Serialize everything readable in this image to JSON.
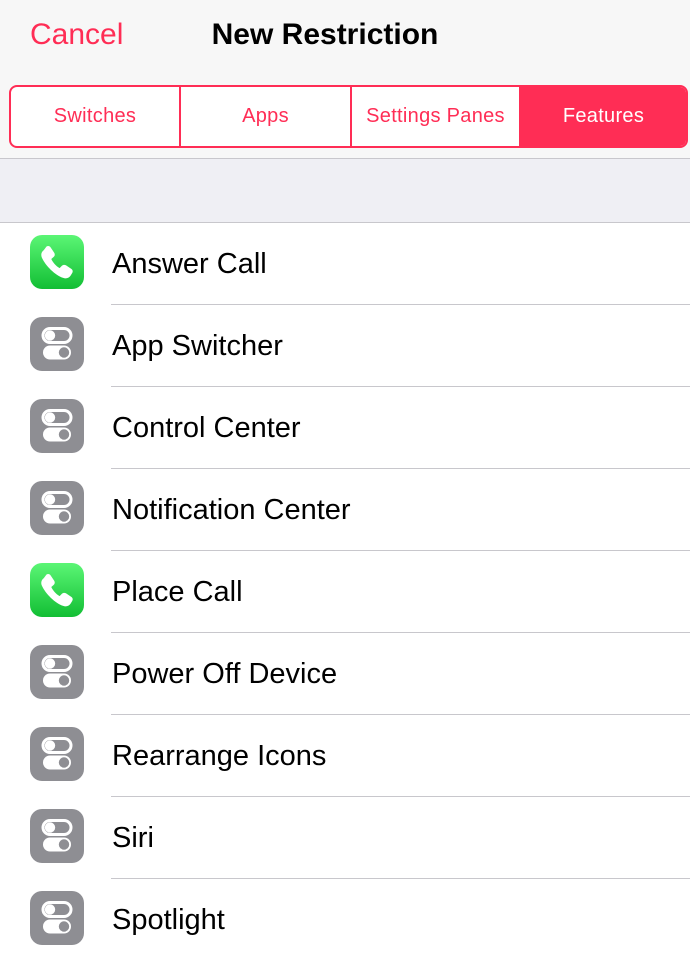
{
  "nav": {
    "cancel_label": "Cancel",
    "title": "New Restriction"
  },
  "segments": [
    {
      "label": "Switches",
      "selected": false
    },
    {
      "label": "Apps",
      "selected": false
    },
    {
      "label": "Settings Panes",
      "selected": false
    },
    {
      "label": "Features",
      "selected": true
    }
  ],
  "features": [
    {
      "label": "Answer Call",
      "icon": "phone-icon"
    },
    {
      "label": "App Switcher",
      "icon": "switches-icon"
    },
    {
      "label": "Control Center",
      "icon": "switches-icon"
    },
    {
      "label": "Notification Center",
      "icon": "switches-icon"
    },
    {
      "label": "Place Call",
      "icon": "phone-icon"
    },
    {
      "label": "Power Off Device",
      "icon": "switches-icon"
    },
    {
      "label": "Rearrange Icons",
      "icon": "switches-icon"
    },
    {
      "label": "Siri",
      "icon": "switches-icon"
    },
    {
      "label": "Spotlight",
      "icon": "switches-icon"
    }
  ],
  "colors": {
    "accent": "#ff2d55",
    "phone_icon_green": "#1fcb43",
    "switch_icon_gray": "#8e8e93"
  }
}
